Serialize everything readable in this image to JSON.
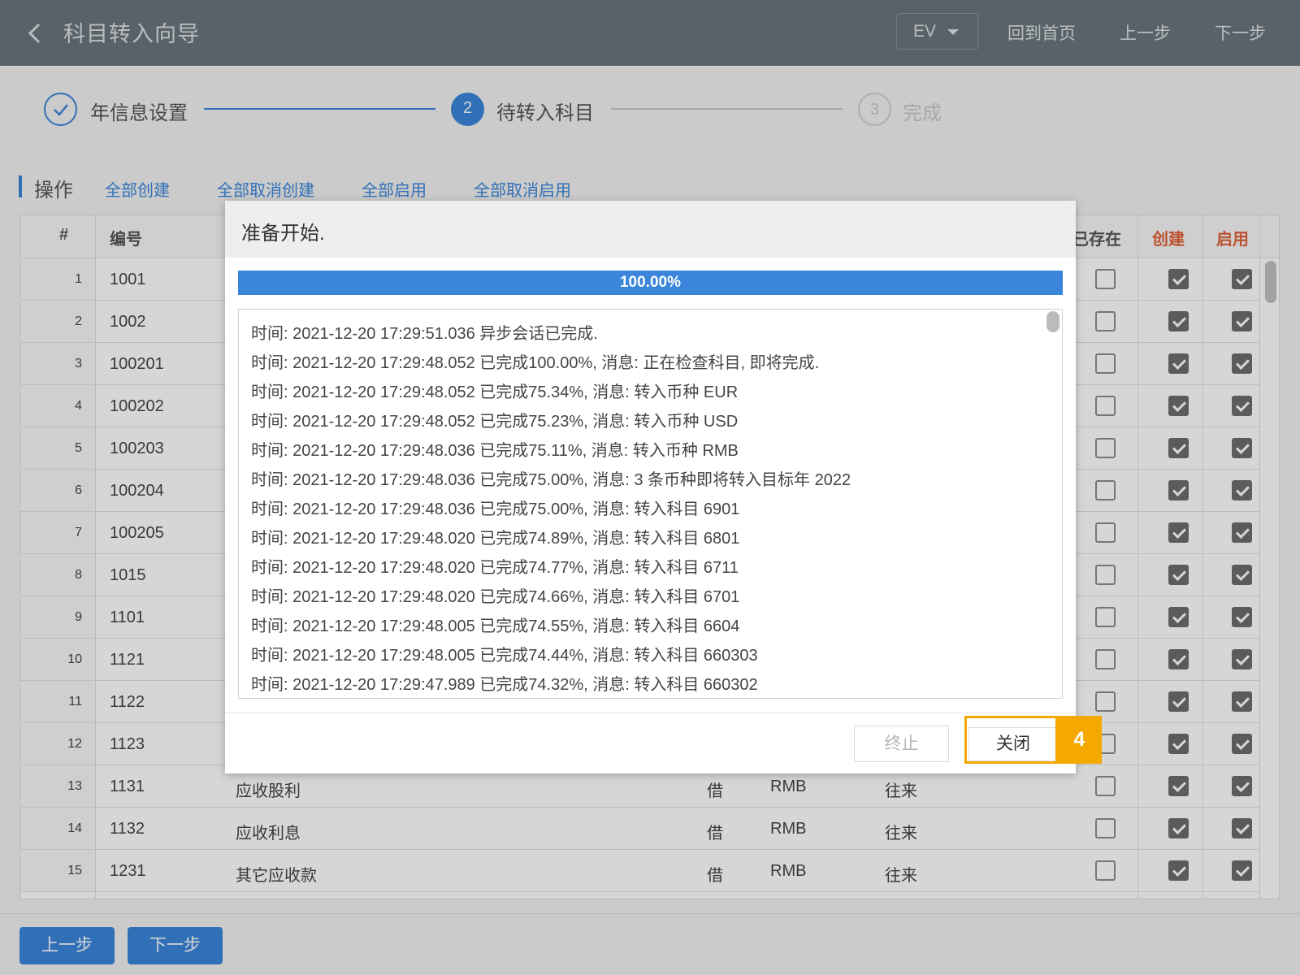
{
  "header": {
    "title": "科目转入向导",
    "env_selector": "EV",
    "home_label": "回到首页",
    "prev_label": "上一步",
    "next_label": "下一步"
  },
  "stepper": {
    "steps": [
      {
        "index": "",
        "label": "年信息设置",
        "status": "done"
      },
      {
        "index": "2",
        "label": "待转入科目",
        "status": "active"
      },
      {
        "index": "3",
        "label": "完成",
        "status": "pending"
      }
    ]
  },
  "operations": {
    "title": "操作",
    "links": [
      "全部创建",
      "全部取消创建",
      "全部启用",
      "全部取消启用"
    ]
  },
  "table": {
    "headers": {
      "index": "#",
      "code": "编号",
      "exists": "已存在",
      "create": "创建",
      "enable": "启用"
    },
    "rows": [
      {
        "index": "1",
        "code": "1001",
        "name": "",
        "direction": "",
        "currency": "",
        "category": "",
        "exists": false,
        "create": true,
        "enable": true
      },
      {
        "index": "2",
        "code": "1002",
        "name": "",
        "direction": "",
        "currency": "",
        "category": "",
        "exists": false,
        "create": true,
        "enable": true
      },
      {
        "index": "3",
        "code": "100201",
        "name": "",
        "direction": "",
        "currency": "",
        "category": "",
        "exists": false,
        "create": true,
        "enable": true
      },
      {
        "index": "4",
        "code": "100202",
        "name": "",
        "direction": "",
        "currency": "",
        "category": "",
        "exists": false,
        "create": true,
        "enable": true
      },
      {
        "index": "5",
        "code": "100203",
        "name": "",
        "direction": "",
        "currency": "",
        "category": "",
        "exists": false,
        "create": true,
        "enable": true
      },
      {
        "index": "6",
        "code": "100204",
        "name": "",
        "direction": "",
        "currency": "",
        "category": "",
        "exists": false,
        "create": true,
        "enable": true
      },
      {
        "index": "7",
        "code": "100205",
        "name": "",
        "direction": "",
        "currency": "",
        "category": "",
        "exists": false,
        "create": true,
        "enable": true
      },
      {
        "index": "8",
        "code": "1015",
        "name": "",
        "direction": "",
        "currency": "",
        "category": "",
        "exists": false,
        "create": true,
        "enable": true
      },
      {
        "index": "9",
        "code": "1101",
        "name": "",
        "direction": "",
        "currency": "",
        "category": "",
        "exists": false,
        "create": true,
        "enable": true
      },
      {
        "index": "10",
        "code": "1121",
        "name": "",
        "direction": "",
        "currency": "",
        "category": "",
        "exists": false,
        "create": true,
        "enable": true
      },
      {
        "index": "11",
        "code": "1122",
        "name": "",
        "direction": "",
        "currency": "",
        "category": "",
        "exists": false,
        "create": true,
        "enable": true
      },
      {
        "index": "12",
        "code": "1123",
        "name": "",
        "direction": "",
        "currency": "",
        "category": "",
        "exists": false,
        "create": true,
        "enable": true
      },
      {
        "index": "13",
        "code": "1131",
        "name": "应收股利",
        "direction": "借",
        "currency": "RMB",
        "category": "往来",
        "exists": false,
        "create": true,
        "enable": true
      },
      {
        "index": "14",
        "code": "1132",
        "name": "应收利息",
        "direction": "借",
        "currency": "RMB",
        "category": "往来",
        "exists": false,
        "create": true,
        "enable": true
      },
      {
        "index": "15",
        "code": "1231",
        "name": "其它应收款",
        "direction": "借",
        "currency": "RMB",
        "category": "往来",
        "exists": false,
        "create": true,
        "enable": true
      }
    ]
  },
  "footer": {
    "prev_label": "上一步",
    "next_label": "下一步"
  },
  "dialog": {
    "title": "准备开始.",
    "progress_value": 1.0,
    "progress_text": "100.00%",
    "log": [
      "时间: 2021-12-20 17:29:51.036 异步会话已完成.",
      "时间: 2021-12-20 17:29:48.052 已完成100.00%, 消息: 正在检查科目, 即将完成.",
      "时间: 2021-12-20 17:29:48.052 已完成75.34%, 消息: 转入币种 EUR",
      "时间: 2021-12-20 17:29:48.052 已完成75.23%, 消息: 转入币种 USD",
      "时间: 2021-12-20 17:29:48.036 已完成75.11%, 消息: 转入币种 RMB",
      "时间: 2021-12-20 17:29:48.036 已完成75.00%, 消息: 3 条币种即将转入目标年 2022",
      "时间: 2021-12-20 17:29:48.036 已完成75.00%, 消息: 转入科目 6901",
      "时间: 2021-12-20 17:29:48.020 已完成74.89%, 消息: 转入科目 6801",
      "时间: 2021-12-20 17:29:48.020 已完成74.77%, 消息: 转入科目 6711",
      "时间: 2021-12-20 17:29:48.020 已完成74.66%, 消息: 转入科目 6701",
      "时间: 2021-12-20 17:29:48.005 已完成74.55%, 消息: 转入科目 6604",
      "时间: 2021-12-20 17:29:48.005 已完成74.44%, 消息: 转入科目 660303",
      "时间: 2021-12-20 17:29:47.989 已完成74.32%, 消息: 转入科目 660302"
    ],
    "stop_label": "终止",
    "close_label": "关闭"
  },
  "highlight": {
    "badge": "4"
  },
  "colors": {
    "accent": "#3b86db",
    "header_bg": "#6b757c",
    "highlight": "#f4a800",
    "column_red": "#e0623a"
  }
}
